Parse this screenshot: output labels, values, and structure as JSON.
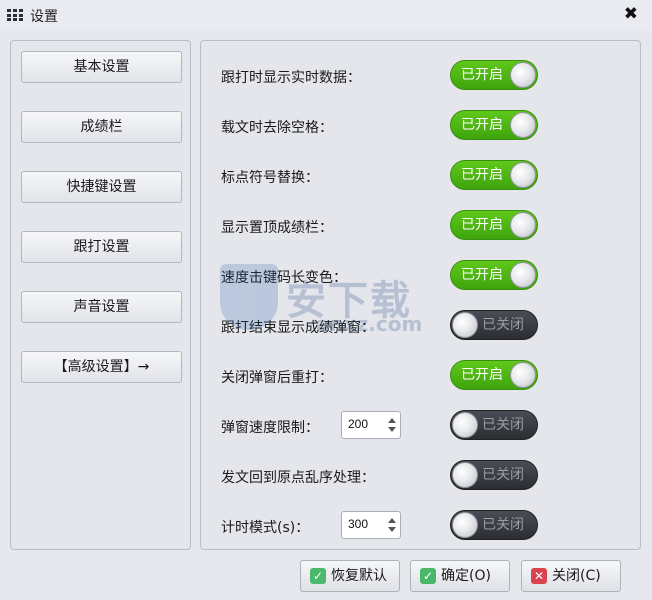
{
  "window": {
    "title": "设置",
    "close_glyph": "✖"
  },
  "sidebar": {
    "items": [
      {
        "label": "基本设置"
      },
      {
        "label": "成绩栏"
      },
      {
        "label": "快捷键设置"
      },
      {
        "label": "跟打设置"
      },
      {
        "label": "声音设置"
      },
      {
        "label": "【高级设置】→"
      }
    ]
  },
  "settings": {
    "on_label": "已开启",
    "off_label": "已关闭",
    "rows": [
      {
        "label": "跟打时显示实时数据：",
        "state": "on"
      },
      {
        "label": "载文时去除空格：",
        "state": "on"
      },
      {
        "label": "标点符号替换：",
        "state": "on"
      },
      {
        "label": "显示置顶成绩栏：",
        "state": "on"
      },
      {
        "label": "速度击键码长变色：",
        "state": "on"
      },
      {
        "label": "跟打结束显示成绩弹窗：",
        "state": "off"
      },
      {
        "label": "关闭弹窗后重打：",
        "state": "on"
      },
      {
        "label": "弹窗速度限制：",
        "state": "off",
        "spin_value": "200"
      },
      {
        "label": "发文回到原点乱序处理：",
        "state": "off"
      },
      {
        "label": "计时模式(s)：",
        "state": "off",
        "spin_value": "300"
      }
    ]
  },
  "footer": {
    "restore_label": "恢复默认",
    "ok_label": "确定(O)",
    "close_label": "关闭(C)"
  },
  "colors": {
    "toggle_on": "#4cb812",
    "toggle_off": "#2f3137",
    "check_icon": "#4cb86a",
    "close_icon": "#d9434d"
  },
  "icons": {
    "app": "grid-menu-icon",
    "restore": "check-icon",
    "ok": "check-icon",
    "close": "x-icon"
  },
  "watermark": {
    "text": "安下载",
    "subtext": "anxz.com"
  }
}
